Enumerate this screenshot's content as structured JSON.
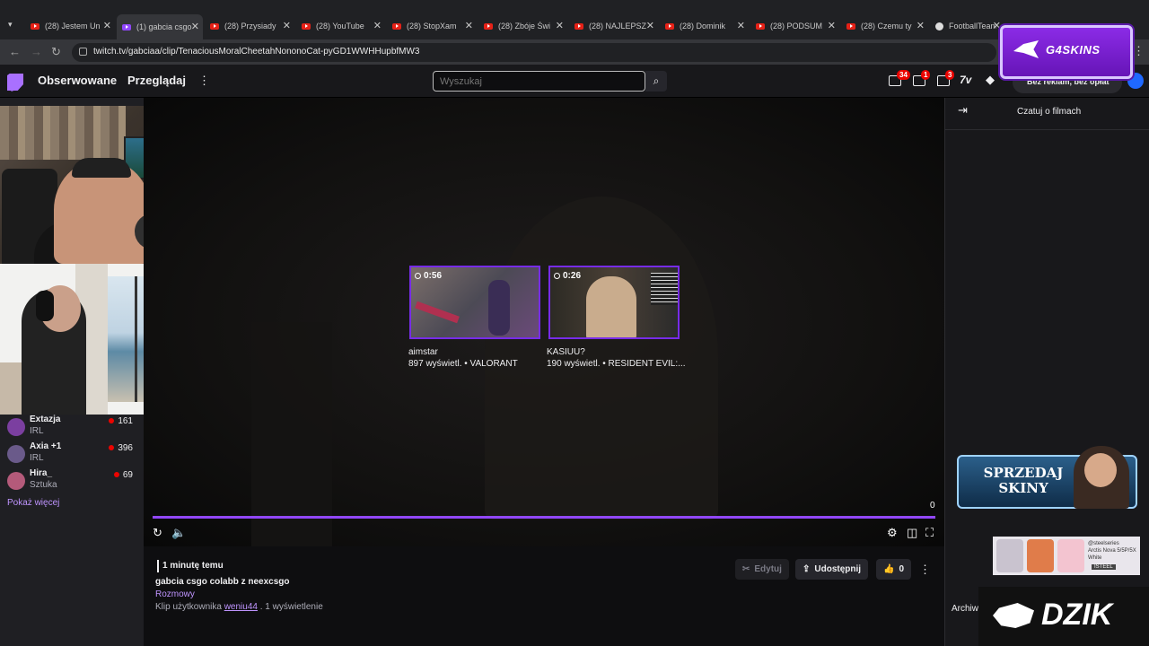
{
  "browser": {
    "tabs": [
      {
        "title": "(28) Jestem Un",
        "icon": "youtube-icon"
      },
      {
        "title": "(1) gabcia csgo",
        "icon": "twitch-icon",
        "active": true
      },
      {
        "title": "(28) Przysiady",
        "icon": "youtube-icon"
      },
      {
        "title": "(28) YouTube",
        "icon": "youtube-icon"
      },
      {
        "title": "(28) StopXam",
        "icon": "youtube-icon"
      },
      {
        "title": "(28) Zbóje Świ",
        "icon": "youtube-icon"
      },
      {
        "title": "(28) NAJLEPSZ",
        "icon": "youtube-icon"
      },
      {
        "title": "(28) Dominik",
        "icon": "youtube-icon"
      },
      {
        "title": "(28) PODSUM",
        "icon": "youtube-icon"
      },
      {
        "title": "(28) Czemu ty",
        "icon": "youtube-icon"
      },
      {
        "title": "FootballTeam",
        "icon": "football-icon"
      }
    ],
    "tab_close": "✕",
    "url": "twitch.tv/gabciaa/clip/TenaciousMoralCheetahNononoCat-pyGD1WWHHupbfMW3"
  },
  "topnav": {
    "following": "Obserwowane",
    "browse": "Przeglądaj",
    "more": "⋮",
    "search_placeholder": "Wyszukaj",
    "badges": {
      "inbox": "34",
      "notifications": "1",
      "whispers": "3"
    },
    "promo": "Bez reklam, bez opłat"
  },
  "overlay_g4skins": {
    "text": "G4SKINS"
  },
  "sidebar": {
    "channels": [
      {
        "name": "Extazja",
        "category": "IRL",
        "viewers": "161",
        "color": "#7b3fa0"
      },
      {
        "name": "Axia +1",
        "category": "IRL",
        "viewers": "396",
        "color": "#6a5a8a"
      },
      {
        "name": "Hira_",
        "category": "Sztuka",
        "viewers": "69",
        "color": "#b45a7a"
      }
    ],
    "show_more": "Pokaż więcej"
  },
  "player": {
    "recommendations": [
      {
        "duration": "0:56",
        "title": "aimstar",
        "subtitle": "897 wyświetl. • VALORANT"
      },
      {
        "duration": "0:26",
        "title": "KASIUU?",
        "subtitle": "190 wyświetl. • RESIDENT EVIL:..."
      }
    ],
    "counter": "0",
    "progress": 1.0
  },
  "clip_meta": {
    "time_ago": "1 minutę temu",
    "title": "gabcia csgo colabb z neexcsgo",
    "category": "Rozmowy",
    "clip_by": "Klip użytkownika",
    "author": "weniu44",
    "views": ". 1 wyświetlenie",
    "edit": "Edytuj",
    "share": "Udostępnij",
    "likes": "0"
  },
  "chat": {
    "title": "Czatuj o filmach",
    "archive_label": "Archiw"
  },
  "ads": {
    "sell_skins": "SPRZEDAJ SKINY",
    "steelseries_brand": "@steelseries",
    "steelseries_product": "Arctis Nova 5/5P/5X White",
    "steelseries_tag": "ISTEEL",
    "dzik": "DZIK"
  },
  "colors": {
    "accent": "#9147ff",
    "link": "#bf94ff",
    "live": "#eb0400"
  }
}
